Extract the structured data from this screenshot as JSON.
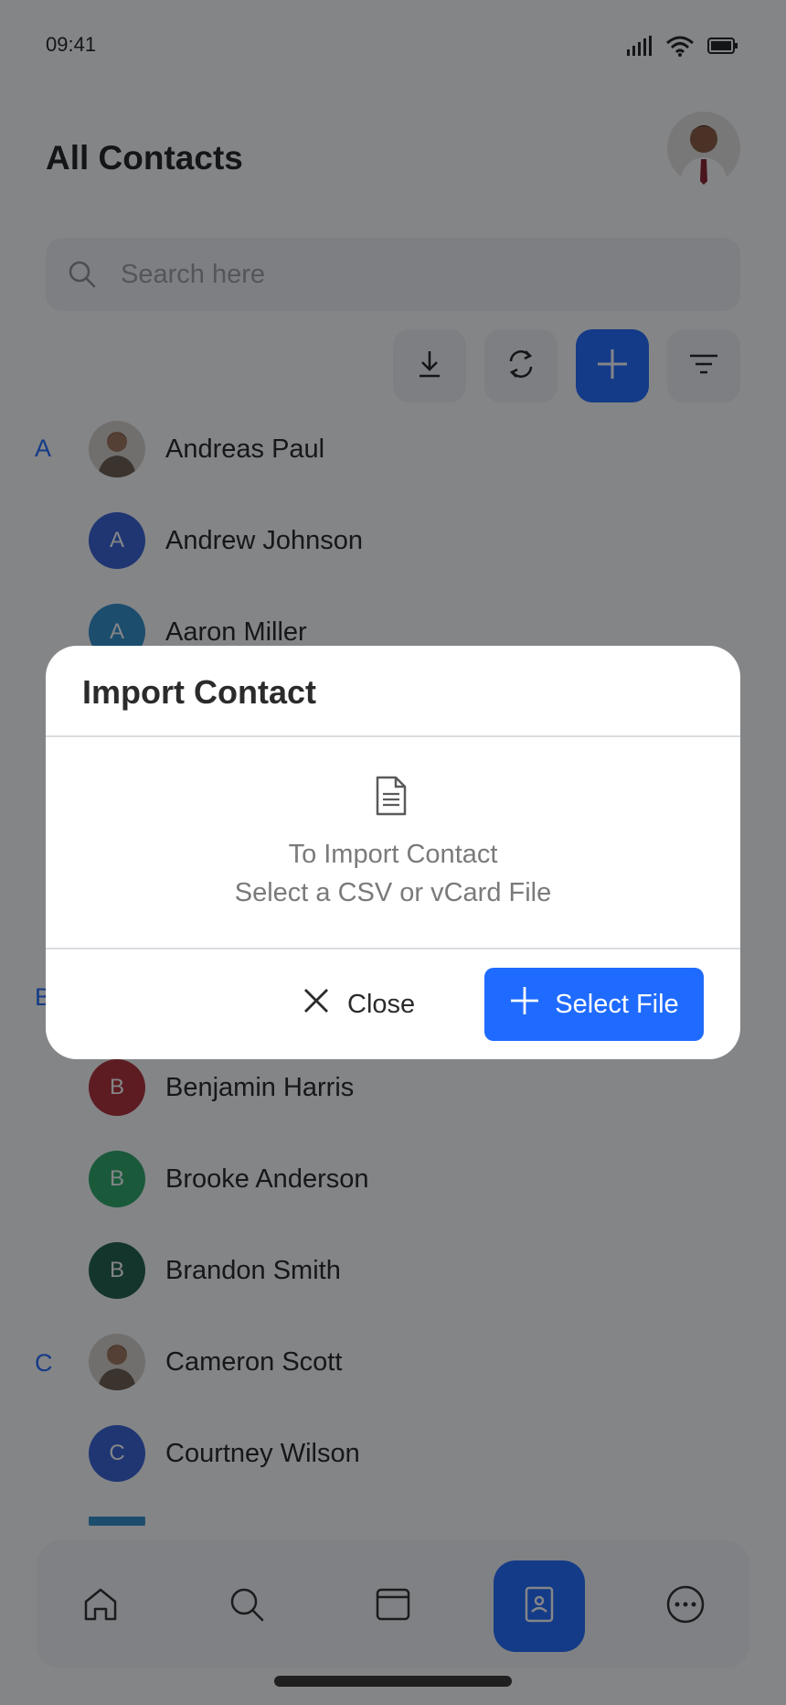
{
  "status_bar": {
    "time": "09:41"
  },
  "header": {
    "title": "All Contacts"
  },
  "search": {
    "placeholder": "Search here"
  },
  "toolbar": {
    "buttons": [
      "download-icon",
      "sync-icon",
      "add-icon",
      "filter-icon"
    ]
  },
  "contacts": [
    {
      "letter": "A",
      "name": "Andreas Paul",
      "initial": "",
      "color": "#b9a99a"
    },
    {
      "letter": "",
      "name": "Andrew Johnson",
      "initial": "A",
      "color": "#3561d6"
    },
    {
      "letter": "",
      "name": "Aaron Miller",
      "initial": "A",
      "color": "#2f8ecb"
    },
    {
      "letter": "B",
      "name": "",
      "initial": "",
      "color": ""
    },
    {
      "letter": "",
      "name": "Benjamin Harris",
      "initial": "B",
      "color": "#b02c35"
    },
    {
      "letter": "",
      "name": "Brooke Anderson",
      "initial": "B",
      "color": "#2aa866"
    },
    {
      "letter": "",
      "name": "Brandon Smith",
      "initial": "B",
      "color": "#1d5e48"
    },
    {
      "letter": "C",
      "name": "Cameron Scott",
      "initial": "",
      "color": "#b9a99a"
    },
    {
      "letter": "",
      "name": "Courtney Wilson",
      "initial": "C",
      "color": "#3561d6"
    }
  ],
  "modal": {
    "title": "Import Contact",
    "line1": "To Import Contact",
    "line2": "Select a CSV or vCard File",
    "close_label": "Close",
    "select_label": "Select File"
  },
  "nav": {
    "items": [
      "home-icon",
      "search-icon",
      "calendar-icon",
      "contacts-icon",
      "more-icon"
    ],
    "active": "contacts-icon"
  },
  "colors": {
    "accent": "#1f6bff",
    "letter": "#1f6bff"
  }
}
